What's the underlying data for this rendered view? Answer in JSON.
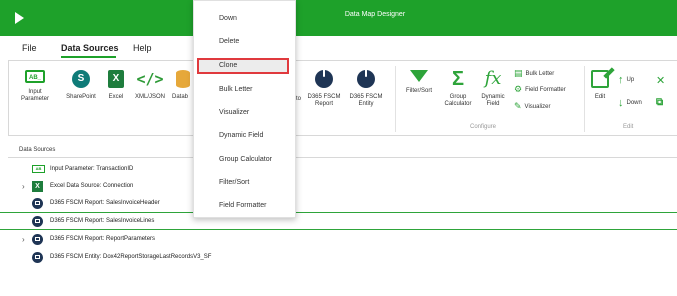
{
  "app": {
    "title": "Data Map Designer"
  },
  "menu_tabs": [
    {
      "label": "File"
    },
    {
      "label": "Data Sources"
    },
    {
      "label": "Help"
    }
  ],
  "ribbon": {
    "input_parameter": "Input Parameter",
    "sharepoint": "SharePoint",
    "excel": "Excel",
    "xml_json": "XML/JSON",
    "database_partial": "Datab",
    "to_partial": "to",
    "d365_report": "D365 FSCM Report",
    "d365_entity": "D365 FSCM Entity",
    "filter_sort": "Filter/Sort",
    "group_calculator": "Group Calculator",
    "dynamic_field": "Dynamic Field",
    "bulk_letter": "Bulk Letter",
    "field_formatter": "Field Formatter",
    "visualizer": "Visualizer",
    "configure_group": "Configure",
    "edit": "Edit",
    "up": "Up",
    "down": "Down",
    "edit_group": "Edit"
  },
  "data_sources": {
    "header": "Data Sources",
    "items": [
      {
        "label": "Input Parameter: TransactionID",
        "icon": "input-parameter-icon",
        "expandable": false
      },
      {
        "label": "Excel Data Source: Connection",
        "icon": "excel-icon",
        "expandable": true
      },
      {
        "label": "D365 FSCM Report: SalesInvoiceHeader",
        "icon": "d365-icon",
        "expandable": false
      },
      {
        "label": "D365 FSCM Report: SalesInvoiceLines",
        "icon": "d365-icon",
        "expandable": false,
        "selected": true
      },
      {
        "label": "D365 FSCM Report: ReportParameters",
        "icon": "d365-icon",
        "expandable": true
      },
      {
        "label": "D365 FSCM Entity: Dox42ReportStorageLastRecordsV3_SF",
        "icon": "d365-icon",
        "expandable": false
      }
    ]
  },
  "context_menu": {
    "items": [
      {
        "label": "Down"
      },
      {
        "label": "Delete"
      },
      {
        "label": "Clone",
        "highlighted": true
      },
      {
        "label": "Bulk Letter"
      },
      {
        "label": "Visualizer"
      },
      {
        "label": "Dynamic Field"
      },
      {
        "label": "Group Calculator"
      },
      {
        "label": "Filter/Sort"
      },
      {
        "label": "Field Formatter"
      }
    ]
  },
  "colors": {
    "accent": "#1ea12a",
    "highlight_border": "#e0393d",
    "dark_icon": "#1f3555"
  }
}
